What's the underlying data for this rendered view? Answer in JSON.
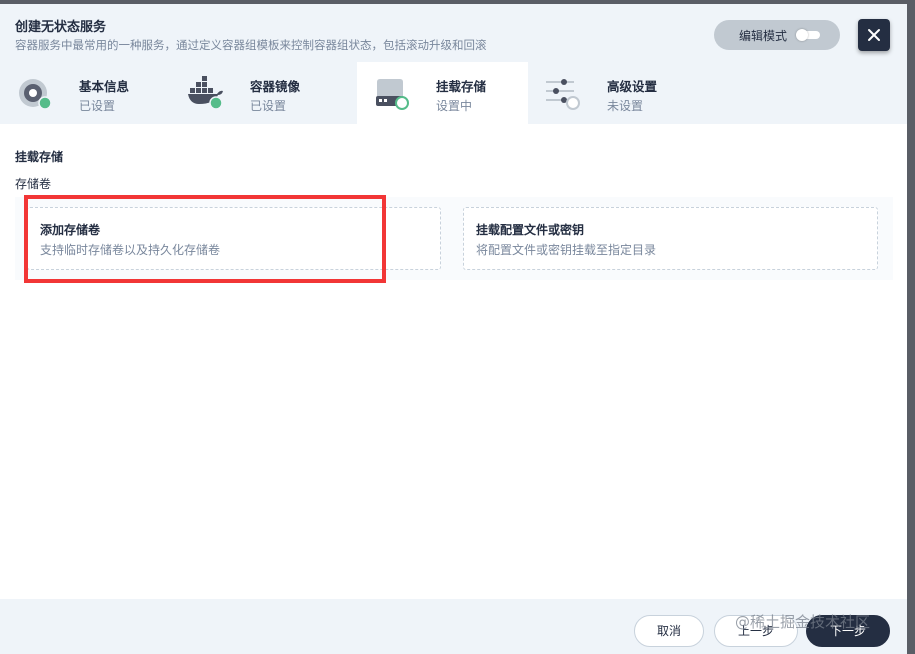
{
  "header": {
    "title": "创建无状态服务",
    "subtitle": "容器服务中最常用的一种服务，通过定义容器组模板来控制容器组状态，包括滚动升级和回滚",
    "edit_mode_label": "编辑模式",
    "close_icon": "close-icon"
  },
  "tabs": [
    {
      "label": "基本信息",
      "status": "已设置",
      "icon": "disk-icon",
      "active": false
    },
    {
      "label": "容器镜像",
      "status": "已设置",
      "icon": "docker-icon",
      "active": false
    },
    {
      "label": "挂载存储",
      "status": "设置中",
      "icon": "hard-drive-icon",
      "active": true
    },
    {
      "label": "高级设置",
      "status": "未设置",
      "icon": "sliders-icon",
      "active": false
    }
  ],
  "main": {
    "section_title": "挂载存储",
    "section_sub": "存储卷",
    "cards": [
      {
        "title": "添加存储卷",
        "desc": "支持临时存储卷以及持久化存储卷"
      },
      {
        "title": "挂载配置文件或密钥",
        "desc": "将配置文件或密钥挂载至指定目录"
      }
    ]
  },
  "footer": {
    "cancel_label": "取消",
    "prev_label": "上一步",
    "next_label": "下一步"
  },
  "watermark": "@稀土掘金技术社区",
  "colors": {
    "dark": "#242e42",
    "light_bg": "#eff4f9",
    "status_done": "#55bc8a",
    "highlight": "#f23636"
  }
}
